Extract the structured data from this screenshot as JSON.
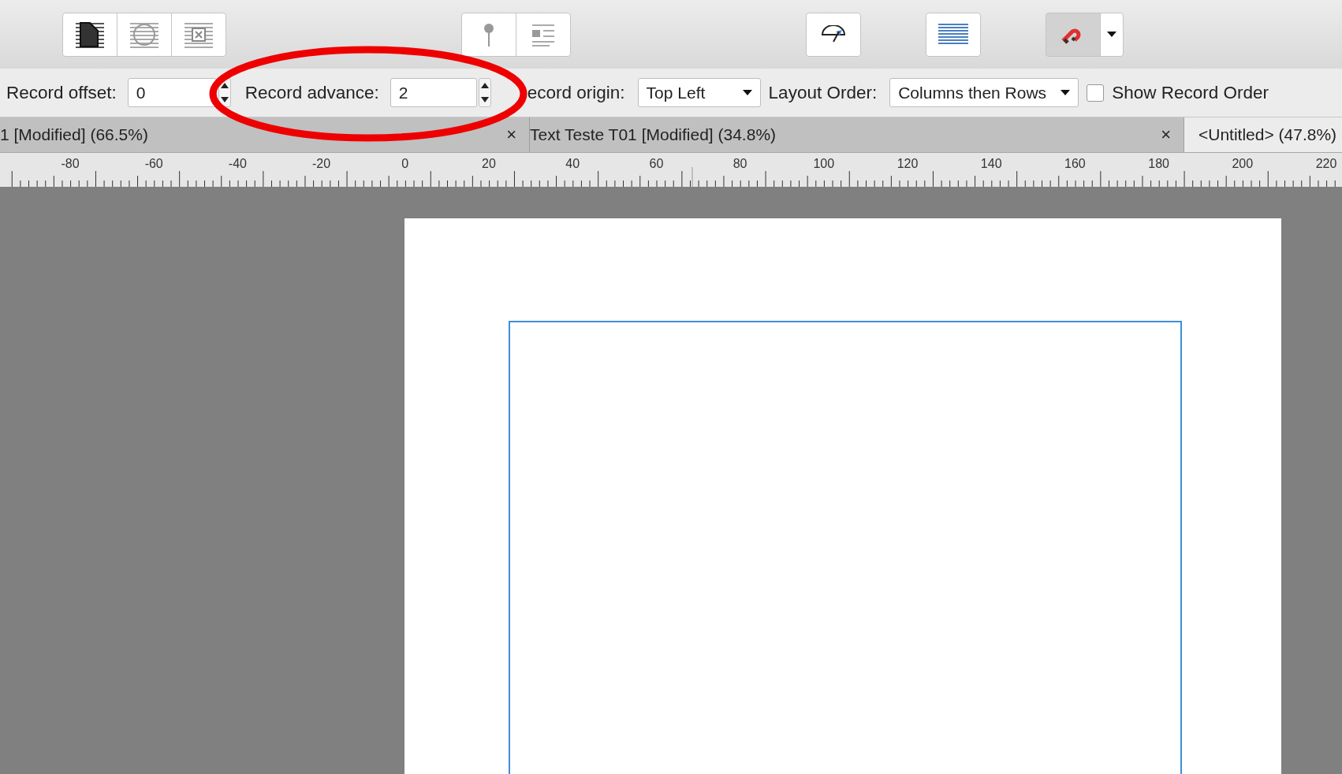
{
  "toolbar": {
    "groups": [
      {
        "buttons": [
          {
            "kind": "page",
            "pressed": false
          },
          {
            "kind": "circle",
            "pressed": false
          },
          {
            "kind": "cross",
            "pressed": false
          }
        ]
      },
      {
        "buttons": [
          {
            "kind": "pin",
            "pressed": false
          },
          {
            "kind": "wrap",
            "pressed": false
          }
        ]
      },
      {
        "buttons": [
          {
            "kind": "gauge",
            "pressed": false
          }
        ]
      },
      {
        "buttons": [
          {
            "kind": "lines",
            "pressed": false
          }
        ]
      },
      {
        "buttons": [
          {
            "kind": "magnet",
            "pressed": true
          },
          {
            "kind": "caret",
            "pressed": false
          }
        ]
      }
    ]
  },
  "options_bar": {
    "items": [
      {
        "kind": "spin",
        "label": "Record offset:",
        "value": "0"
      },
      {
        "kind": "spin",
        "label": "Record advance:",
        "value": "2"
      },
      {
        "kind": "dropdown",
        "label": "ecord origin:",
        "value": "Top Left"
      },
      {
        "kind": "dropdown",
        "label": "Layout Order:",
        "value": "Columns then Rows"
      },
      {
        "kind": "checkbox",
        "label": "Show Record Order",
        "checked": false
      }
    ]
  },
  "tabs": [
    {
      "label": "1 [Modified] (66.5%)",
      "selected": false,
      "close": "×"
    },
    {
      "label": "Text Teste T01 [Modified] (34.8%)",
      "selected": false,
      "close": "×"
    },
    {
      "label": "<Untitled> (47.8%)",
      "selected": true
    }
  ],
  "ruler": {
    "labels": [
      "-80",
      "-60",
      "-40",
      "-20",
      "0",
      "20",
      "40",
      "60",
      "80",
      "100",
      "120",
      "140",
      "160",
      "180",
      "200",
      "220"
    ]
  },
  "annotation": {
    "kind": "ellipse"
  }
}
